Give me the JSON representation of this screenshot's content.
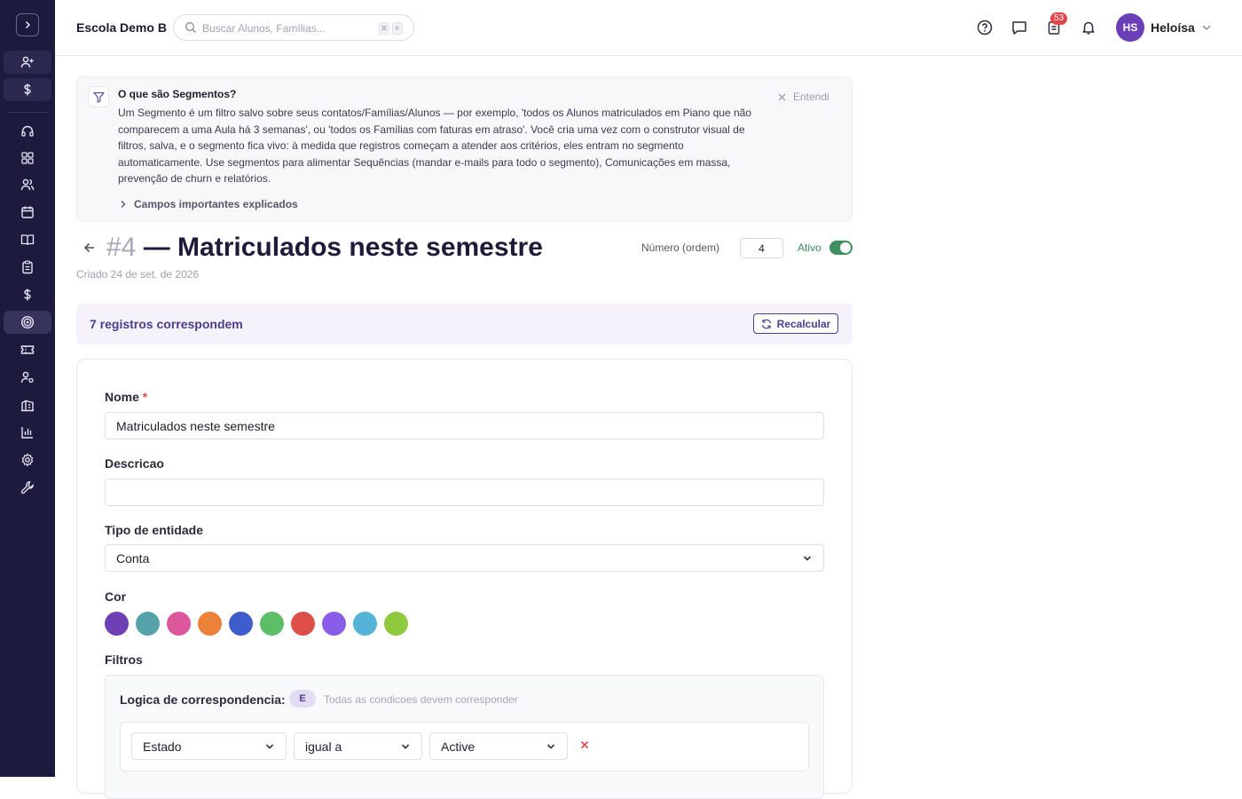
{
  "app": {
    "school_name": "Escola Demo B",
    "search_placeholder": "Buscar Alunos, Famílias...",
    "search_kbd": [
      "⌘",
      "K"
    ],
    "notifications_badge": "53",
    "user_initials": "HS",
    "user_name": "Heloísa"
  },
  "sidebar": {
    "items": [
      "add-user-icon",
      "dollar-icon",
      "headset-icon",
      "grid-icon",
      "users-icon",
      "calendar-icon",
      "book-icon",
      "clipboard-icon",
      "dollar-icon",
      "target-icon",
      "ticket-icon",
      "user-settings-icon",
      "building-icon",
      "bar-chart-icon",
      "gear-icon",
      "wrench-icon"
    ]
  },
  "info": {
    "title": "O que são Segmentos?",
    "body": "Um Segmento é um filtro salvo sobre seus contatos/Famílias/Alunos — por exemplo, 'todos os Alunos matriculados em Piano que não comparecem a uma Aula há 3 semanas', ou 'todos os Famílias com faturas em atraso'. Você cria uma vez com o construtor visual de filtros, salva, e o segmento fica vivo: à medida que registros começam a atender aos critérios, eles entram no segmento automaticamente. Use segmentos para alimentar Sequências (mandar e-mails para todo o segmento), Comunicações em massa, prevenção de churn e relatórios.",
    "expand_link": "Campos importantes explicados",
    "dismiss": "Entendi"
  },
  "segment": {
    "number": "#4",
    "title": "— Matriculados neste semestre",
    "created": "Criado 24 de set. de 2026",
    "order_label": "Número (ordem)",
    "order_value": "4",
    "active_label": "Ativo",
    "active": true
  },
  "matches": {
    "text": "7 registros correspondem",
    "recalc_label": "Recalcular"
  },
  "form": {
    "name_label": "Nome",
    "required_mark": "*",
    "name_value": "Matriculados neste semestre",
    "description_label": "Descricao",
    "description_value": "",
    "entity_label": "Tipo de entidade",
    "entity_value": "Conta",
    "color_label": "Cor",
    "colors": [
      "#6f3fb6",
      "#55a3a8",
      "#dd579d",
      "#ec813a",
      "#3f5ccc",
      "#5cbf68",
      "#dd4f47",
      "#8a5de8",
      "#54b4d8",
      "#8ec93e"
    ],
    "filters_label": "Filtros"
  },
  "filters": {
    "logic_label": "Logica de correspondencia:",
    "logic_badge": "E",
    "logic_hint": "Todas as condicoes devem corresponder",
    "conditions": [
      {
        "field": "Estado",
        "operator": "igual a",
        "value": "Active"
      }
    ]
  }
}
